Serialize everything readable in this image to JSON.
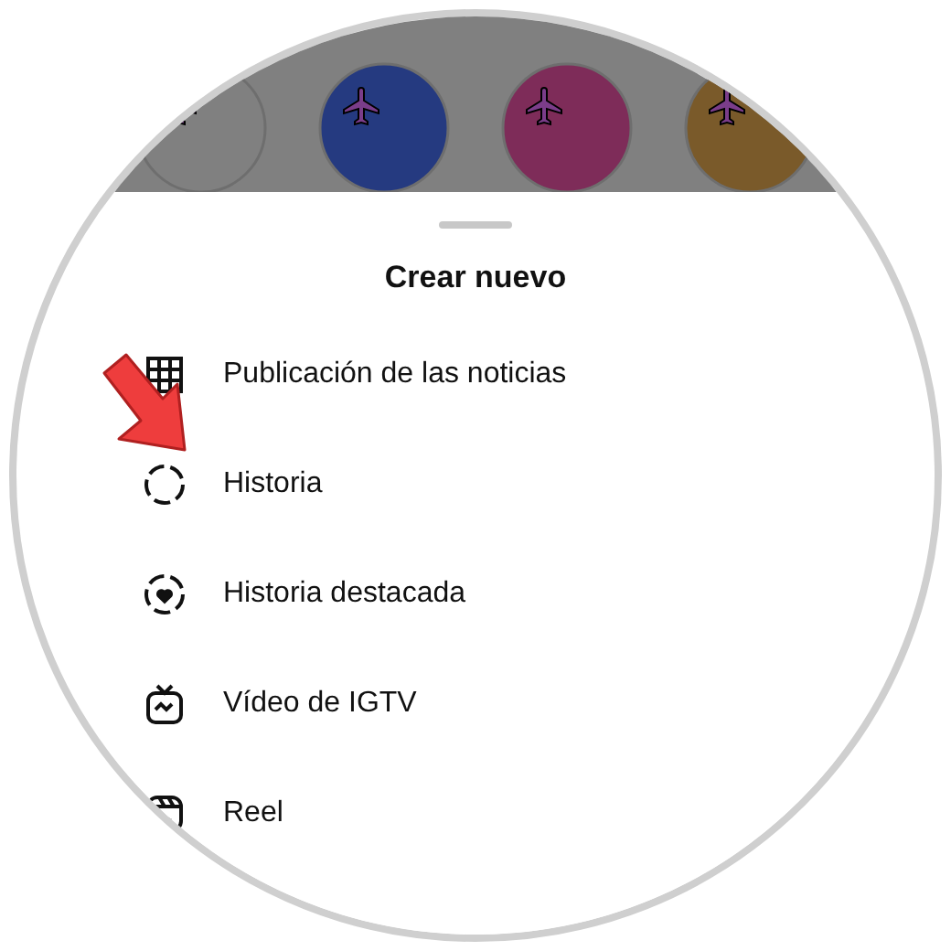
{
  "stories": [
    {
      "color": "#808080"
    },
    {
      "color": "#253a80"
    },
    {
      "color": "#7e2c59"
    },
    {
      "color": "#7a5a2a"
    }
  ],
  "sheet": {
    "title": "Crear nuevo",
    "items": [
      {
        "kind": "grid",
        "label": "Publicación de las noticias"
      },
      {
        "kind": "story",
        "label": "Historia"
      },
      {
        "kind": "highlight",
        "label": "Historia destacada"
      },
      {
        "kind": "igtv",
        "label": "Vídeo de IGTV"
      },
      {
        "kind": "reel",
        "label": "Reel"
      }
    ]
  }
}
